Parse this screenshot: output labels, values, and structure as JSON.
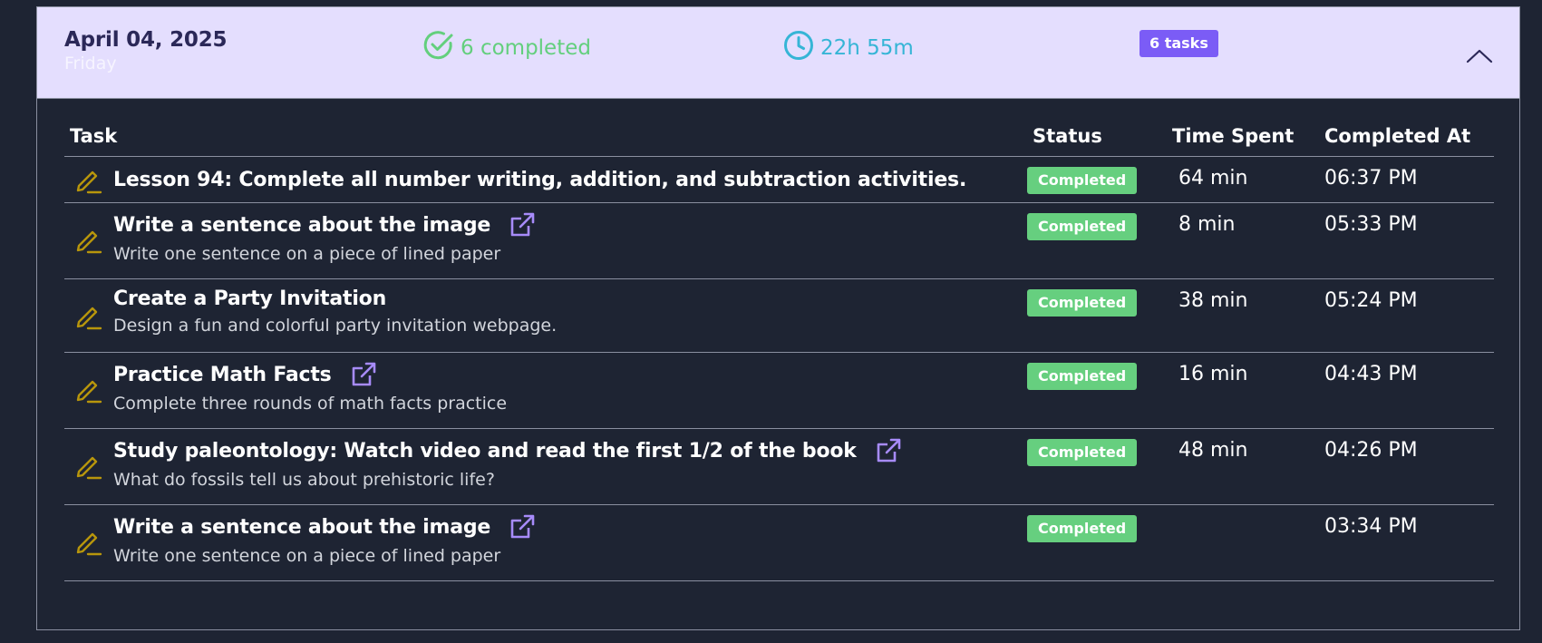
{
  "header": {
    "date": "April 04, 2025",
    "weekday": "Friday",
    "completed_count": "6 completed",
    "time_total": "22h 55m",
    "tasks_badge": "6 tasks",
    "colors": {
      "header_bg": "#e4defe",
      "completed_green": "#63cf7d",
      "time_blue": "#36b5d6",
      "badge_purple": "#7b5cf6"
    },
    "icons": [
      "check-circle-icon",
      "clock-icon",
      "chevron-up-icon"
    ]
  },
  "table": {
    "columns": {
      "task": "Task",
      "status": "Status",
      "time_spent": "Time Spent",
      "completed_at": "Completed At"
    },
    "rows": [
      {
        "title": "Lesson 94: Complete all number writing, addition, and subtraction activities.",
        "description": "",
        "status": "Completed",
        "time_spent": "64 min",
        "completed_at": "06:37 PM",
        "has_link": false
      },
      {
        "title": "Write a sentence about the image",
        "description": "Write one sentence on a piece of lined paper",
        "status": "Completed",
        "time_spent": "8 min",
        "completed_at": "05:33 PM",
        "has_link": true
      },
      {
        "title": "Create a Party Invitation",
        "description": "Design a fun and colorful party invitation webpage.",
        "status": "Completed",
        "time_spent": "38 min",
        "completed_at": "05:24 PM",
        "has_link": false
      },
      {
        "title": "Practice Math Facts",
        "description": "Complete three rounds of math facts practice",
        "status": "Completed",
        "time_spent": "16 min",
        "completed_at": "04:43 PM",
        "has_link": true
      },
      {
        "title": "Study paleontology: Watch video and read the first 1/2 of the book",
        "description": "What do fossils tell us about prehistoric life?",
        "status": "Completed",
        "time_spent": "48 min",
        "completed_at": "04:26 PM",
        "has_link": true
      },
      {
        "title": "Write a sentence about the image",
        "description": "Write one sentence on a piece of lined paper",
        "status": "Completed",
        "time_spent": "",
        "completed_at": "03:34 PM",
        "has_link": true
      }
    ],
    "row_icon": "pencil-icon",
    "link_icon": "external-link-icon",
    "colors": {
      "status_green": "#66cf7f",
      "pencil_gold": "#b8960c",
      "link_purple": "#a78bfa"
    }
  }
}
